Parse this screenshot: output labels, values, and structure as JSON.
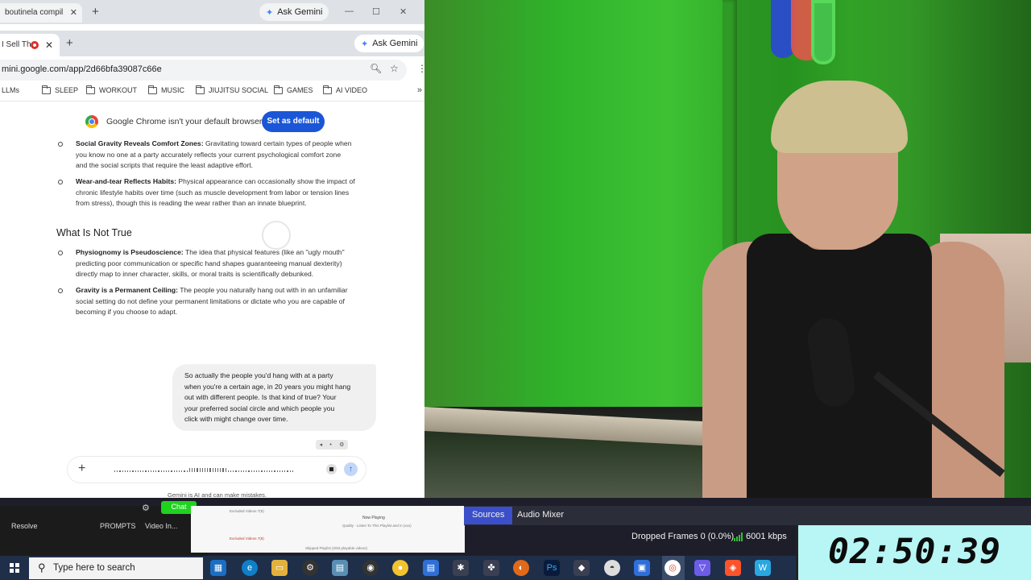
{
  "browser": {
    "back_tab_title": "boutinela compil",
    "back_gemini_label": "Ask Gemini",
    "front_tab_title": "I Sell Th",
    "front_gemini_label": "Ask Gemini",
    "url": "mini.google.com/app/2d66bfa39087c66e",
    "bookmarks": [
      "LLMs",
      "SLEEP",
      "WORKOUT",
      "MUSIC",
      "JIUJITSU SOCIAL",
      "GAMES",
      "AI VIDEO"
    ],
    "infobar_text": "Google Chrome isn't your default browser",
    "infobar_button": "Set as default"
  },
  "chat": {
    "points_true": [
      {
        "title": "Social Gravity Reveals Comfort Zones:",
        "lines": [
          "Gravitating toward certain types of people when",
          "you know no one at a party accurately reflects your current psychological comfort zone",
          "and the social scripts that require the least adaptive effort."
        ]
      },
      {
        "title": "Wear-and-tear Reflects Habits:",
        "lines": [
          "Physical appearance can occasionally show the impact of",
          "chronic lifestyle habits over time (such as muscle development from labor or tension lines",
          "from stress), though this is reading the wear rather than an innate blueprint."
        ]
      }
    ],
    "heading_not_true": "What Is Not True",
    "points_not_true": [
      {
        "title": "Physiognomy is Pseudoscience:",
        "lines": [
          "The idea that physical features (like an \"ugly mouth\"",
          "predicting poor communication or specific hand shapes guaranteeing manual dexterity)",
          "directly map to inner character, skills, or moral traits is scientifically debunked."
        ]
      },
      {
        "title": "Gravity is a Permanent Ceiling:",
        "lines": [
          "The people you naturally hang out with in an unfamiliar",
          "social setting do not define your permanent limitations or dictate who you are capable of",
          "becoming if you choose to adapt."
        ]
      }
    ],
    "user_message": [
      "So actually the people you'd hang with at a party",
      "when you're a certain age, in 20 years you might hang",
      "out with different people. Is that kind of true? Your",
      "your preferred social circle and which people you",
      "click with might change over time."
    ],
    "disclaimer": "Gemini is AI and can make mistakes."
  },
  "obs": {
    "green_button": "Chat",
    "labels": [
      "Resolve",
      "PROMPTS",
      "Video In..."
    ],
    "tabs": [
      "Sources",
      "Audio Mixer"
    ],
    "dropped_frames": "Dropped Frames 0 (0.0%)",
    "bitrate": "6001 kbps",
    "timer": "02:50:39",
    "doc_now_playing": "Now Playing",
    "doc_lines": [
      "Quality · Listen To This Playlist and in (xxx)",
      "Excluded Videos 7(8)",
      "Skipped Playlist (2/83 playable videos)"
    ]
  },
  "taskbar": {
    "search_placeholder": "Type here to search"
  },
  "colors": {
    "accent_blue": "#1a56d6",
    "obs_tab_active": "#3a4fc9",
    "timer_bg": "#b8f5f5",
    "webcam_green": "#2fb32a"
  }
}
